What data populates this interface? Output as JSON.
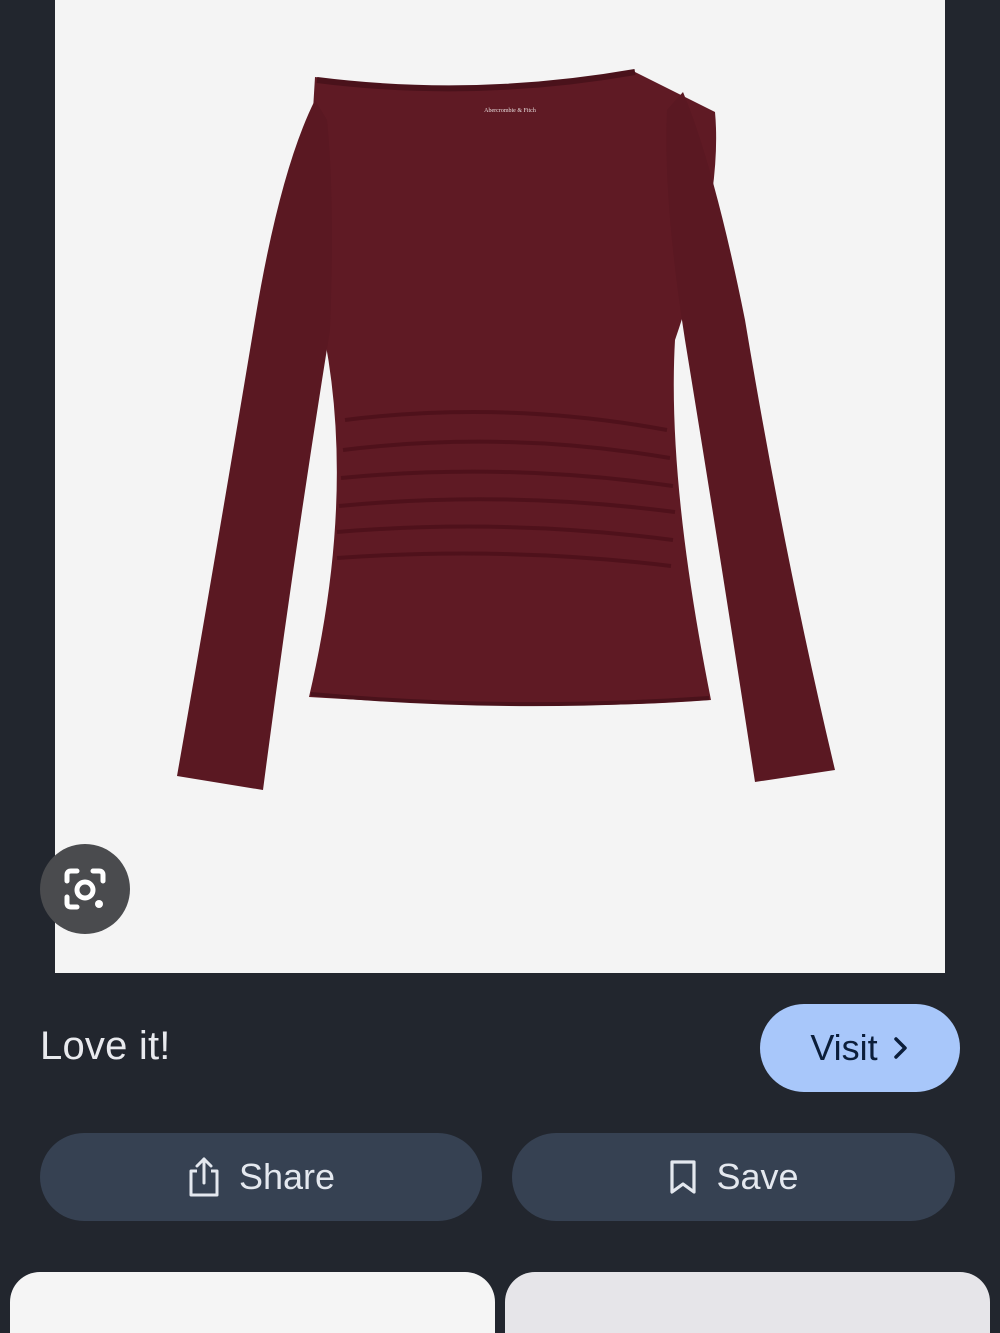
{
  "product": {
    "image_alt": "Burgundy long-sleeve ruched top",
    "garment_color": "#5f1a24",
    "label_text": "Abercrombie & Fitch"
  },
  "lens": {
    "icon": "google-lens-icon"
  },
  "caption": "Love it!",
  "visit": {
    "label": "Visit",
    "icon": "chevron-right-icon"
  },
  "actions": {
    "share_label": "Share",
    "share_icon": "share-icon",
    "save_label": "Save",
    "save_icon": "bookmark-icon"
  },
  "colors": {
    "background": "#22262e",
    "visit_button": "#a8c7fa",
    "action_button": "#364152"
  }
}
